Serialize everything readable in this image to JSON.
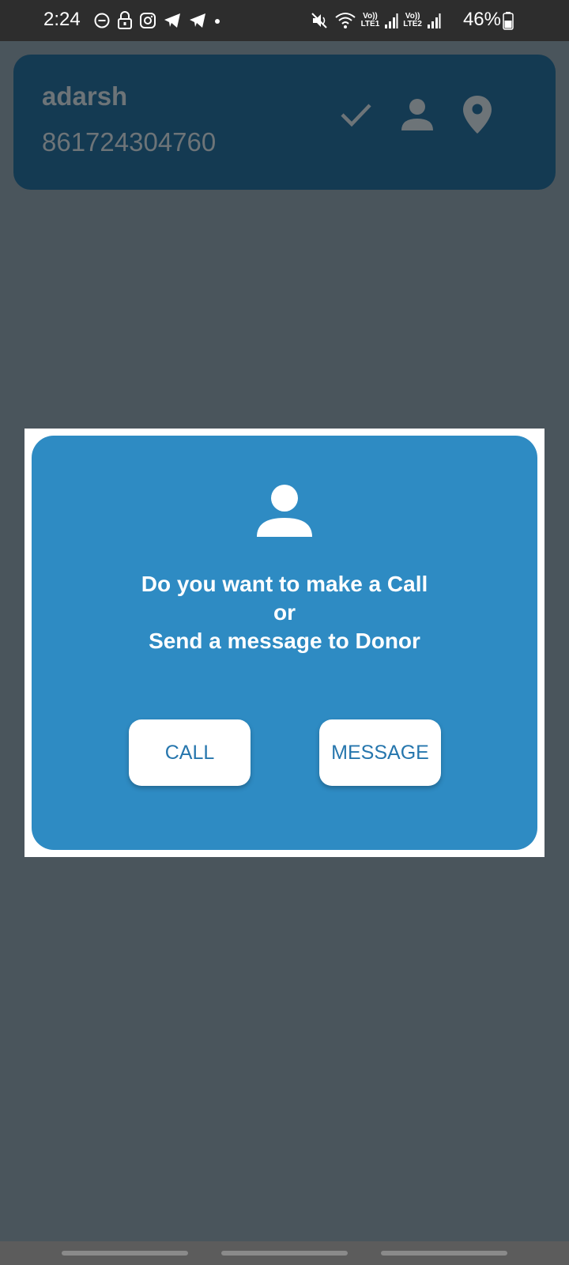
{
  "status_bar": {
    "time": "2:24",
    "lte1": "LTE1",
    "lte2": "LTE2",
    "vo": "Vo))",
    "battery": "46%",
    "icons": [
      "do-not-disturb-icon",
      "lock-icon",
      "instagram-icon",
      "telegram-icon",
      "telegram-icon",
      "dot-icon",
      "mute-icon",
      "wifi-icon",
      "signal-icon",
      "signal-icon",
      "battery-icon"
    ]
  },
  "contact": {
    "name": "adarsh",
    "phone": "861724304760",
    "icons": [
      "check-icon",
      "person-icon",
      "location-pin-icon"
    ]
  },
  "dialog": {
    "line1": "Do you want to make a Call",
    "line2": "or",
    "line3": "Send a message to Donor",
    "call_label": "CALL",
    "message_label": "MESSAGE",
    "icon": "person-icon"
  },
  "colors": {
    "background": "#4a555c",
    "card": "#143a52",
    "dialog": "#2e8bc3",
    "button_text": "#2676ad"
  }
}
